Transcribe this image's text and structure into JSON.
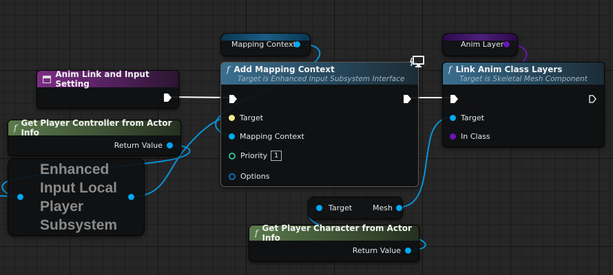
{
  "nodes": {
    "anim_link": {
      "title": "Anim Link and Input Setting"
    },
    "get_controller": {
      "title": "Get Player Controller from Actor Info",
      "output": "Return Value"
    },
    "subsystem": {
      "title_lines": [
        "Enhanced",
        "Input Local",
        "Player",
        "Subsystem"
      ]
    },
    "mapping_var": {
      "label": "Mapping Context"
    },
    "add_mapping": {
      "title": "Add Mapping Context",
      "subtitle": "Target is Enhanced Input Subsystem Interface",
      "pins": {
        "target": "Target",
        "mapping": "Mapping Context",
        "priority": "Priority",
        "priority_value": "1",
        "options": "Options"
      }
    },
    "anim_layer_var": {
      "label": "Anim Layer"
    },
    "link_anim": {
      "title": "Link Anim Class Layers",
      "subtitle": "Target is Skeletal Mesh Component",
      "pins": {
        "target": "Target",
        "in_class": "In Class"
      }
    },
    "break_mesh": {
      "input": "Target",
      "output": "Mesh"
    },
    "get_character": {
      "title": "Get Player Character from Actor Info",
      "output": "Return Value"
    }
  },
  "icons": {
    "function": "function-f-icon",
    "struct": "struct-icon",
    "monitor": "monitor-icon"
  },
  "colors": {
    "object_pin": "#00a8f0",
    "exec_wire": "#ffffff",
    "class_pin": "#6a14b8",
    "integer_pin": "#2db98e",
    "target_pin": "#f4ec8a",
    "header_function": "#3a6f90",
    "header_event": "#7c2c86",
    "header_pure": "#5b7a4c"
  }
}
